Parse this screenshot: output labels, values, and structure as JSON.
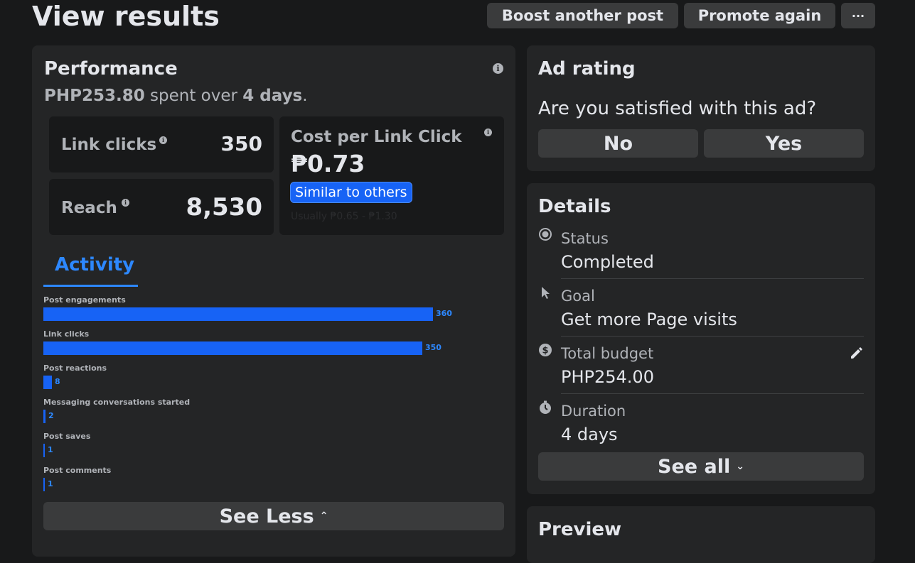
{
  "header": {
    "title": "View results",
    "boost_label": "Boost another post",
    "promote_label": "Promote again",
    "more_label": "···"
  },
  "performance": {
    "title": "Performance",
    "spent_amount": "PHP253.80",
    "spent_mid": " spent over ",
    "spent_days": "4 days",
    "spent_end": ".",
    "link_clicks_label": "Link clicks",
    "link_clicks_value": "350",
    "reach_label": "Reach",
    "reach_value": "8,530",
    "cplc_label": "Cost per Link Click",
    "cplc_value": "₱0.73",
    "cplc_badge": "Similar to others",
    "cplc_range": "Usually ₱0.65 - ₱1.30"
  },
  "activity": {
    "tab_label": "Activity",
    "bars": [
      {
        "label": "Post engagements",
        "value": 360
      },
      {
        "label": "Link clicks",
        "value": 350
      },
      {
        "label": "Post reactions",
        "value": 8
      },
      {
        "label": "Messaging conversations started",
        "value": 2
      },
      {
        "label": "Post saves",
        "value": 1
      },
      {
        "label": "Post comments",
        "value": 1
      }
    ],
    "see_less_label": "See Less"
  },
  "ad_rating": {
    "title": "Ad rating",
    "question": "Are you satisfied with this ad?",
    "no_label": "No",
    "yes_label": "Yes"
  },
  "details": {
    "title": "Details",
    "status_label": "Status",
    "status_value": "Completed",
    "goal_label": "Goal",
    "goal_value": "Get more Page visits",
    "budget_label": "Total budget",
    "budget_value": "PHP254.00",
    "duration_label": "Duration",
    "duration_value": "4 days",
    "see_all_label": "See all"
  },
  "preview": {
    "title": "Preview"
  },
  "colors": {
    "accent": "#1763f5",
    "background": "#18191a",
    "card": "#242526"
  }
}
